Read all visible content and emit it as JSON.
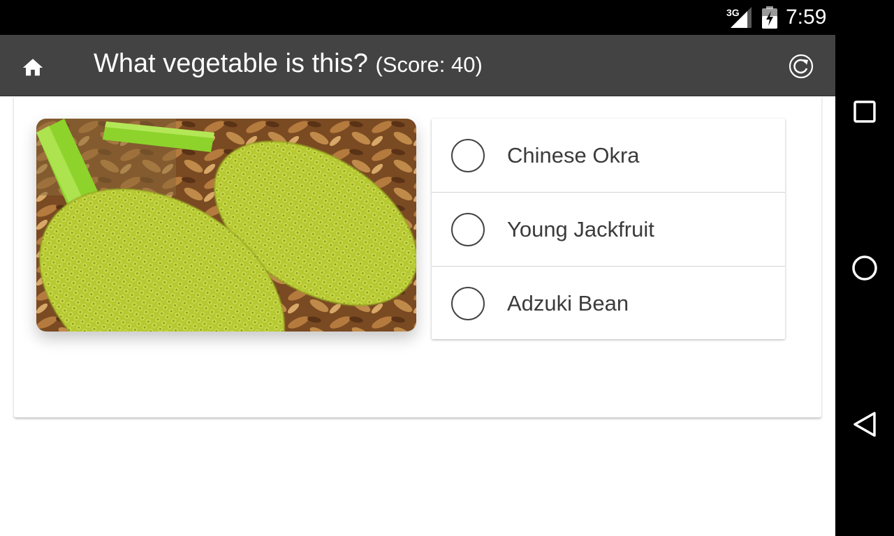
{
  "status_bar": {
    "network_label": "3G",
    "time": "7:59",
    "icons": [
      "signal-icon",
      "battery-charging-icon"
    ]
  },
  "app_bar": {
    "title": "What vegetable is this?",
    "score": "(Score: 40)",
    "home_icon": "home-icon",
    "reset_icon": "refresh-icon"
  },
  "quiz": {
    "image_subject": "Young Jackfruit photo",
    "options": [
      {
        "label": "Chinese Okra",
        "selected": false
      },
      {
        "label": "Young Jackfruit",
        "selected": false
      },
      {
        "label": "Adzuki Bean",
        "selected": false
      }
    ]
  },
  "nav_bar": {
    "icons": [
      "recents-icon",
      "home-circle-icon",
      "back-icon"
    ]
  },
  "colors": {
    "app_bar": "#434343",
    "status_bar": "#000000",
    "fruit_green": "#b3c531",
    "stem_green": "#8dd32c"
  }
}
